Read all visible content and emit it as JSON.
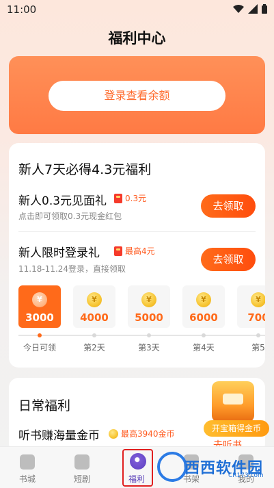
{
  "status_bar": {
    "time": "11:00"
  },
  "page_title": "福利中心",
  "balance_card": {
    "login_label": "登录查看余额"
  },
  "newbie_card": {
    "heading": "新人7天必得4.3元福利",
    "tasks": [
      {
        "title": "新人0.3元见面礼",
        "tag": "0.3元",
        "sub": "点击即可领取0.3元现金红包",
        "button": "去领取"
      },
      {
        "title": "新人限时登录礼",
        "tag": "最高4元",
        "sub": "11.18-11.24登录，直接领取",
        "button": "去领取"
      }
    ],
    "days": [
      {
        "amount": "3000",
        "label": "今日可领"
      },
      {
        "amount": "4000",
        "label": "第2天"
      },
      {
        "amount": "5000",
        "label": "第3天"
      },
      {
        "amount": "6000",
        "label": "第4天"
      },
      {
        "amount": "700",
        "label": "第5"
      }
    ],
    "coin_glyph": "¥"
  },
  "daily_card": {
    "heading": "日常福利",
    "task_title": "听书赚海量金币",
    "task_tag": "最高3940金币",
    "treasure_banner": "开宝箱得金币",
    "treasure_cta": "去听书"
  },
  "tabbar": {
    "tabs": [
      {
        "label": "书城",
        "icon": "home-icon"
      },
      {
        "label": "短剧",
        "icon": "play-icon"
      },
      {
        "label": "福利",
        "icon": "welfare-icon"
      },
      {
        "label": "书架",
        "icon": "bookshelf-icon"
      },
      {
        "label": "我的",
        "icon": "profile-icon"
      }
    ]
  },
  "watermark": {
    "text": "西西软件园",
    "url": "CR173.com"
  },
  "colors": {
    "accent": "#ff6a1a",
    "brand_purple": "#5a3fb8"
  }
}
